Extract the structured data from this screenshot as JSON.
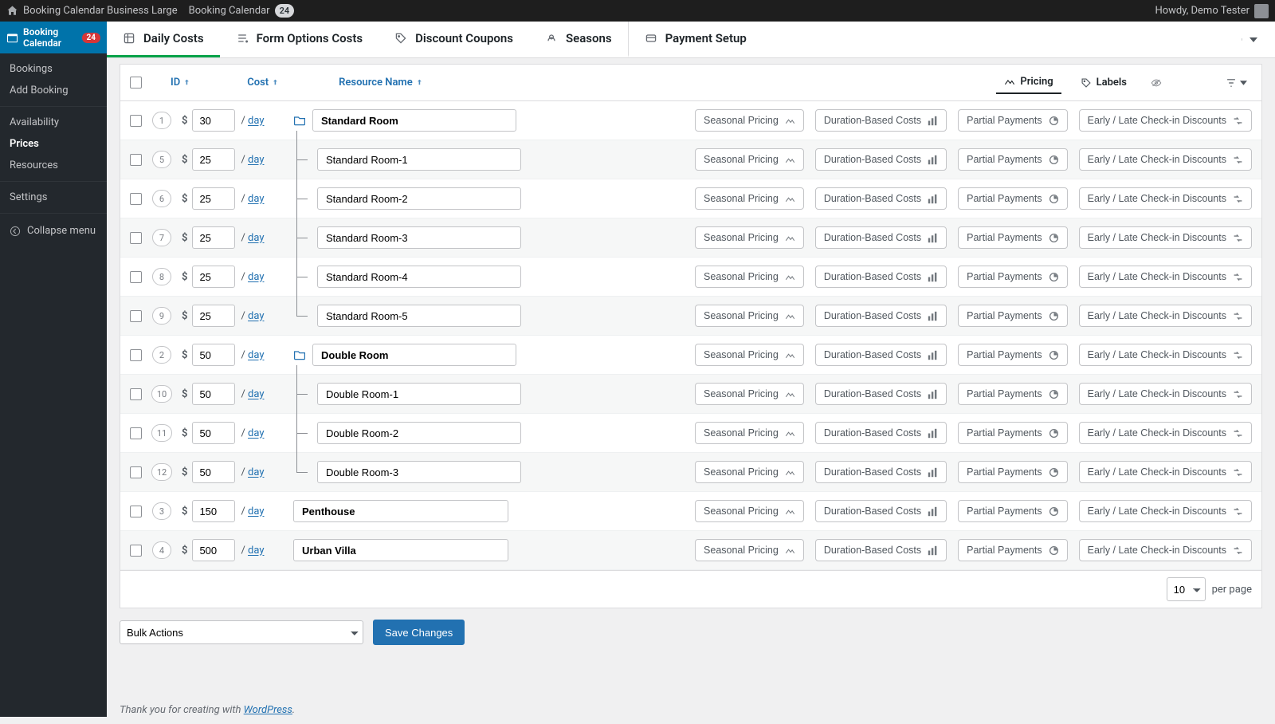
{
  "adminbar": {
    "home_label": "Booking Calendar Business Large",
    "plugin_label": "Booking Calendar",
    "plugin_badge": "24",
    "howdy": "Howdy, Demo Tester"
  },
  "sidebar": {
    "top_label": "Booking Calendar",
    "top_badge": "24",
    "group1": [
      "Bookings",
      "Add Booking"
    ],
    "group2": [
      "Availability",
      "Prices",
      "Resources"
    ],
    "group3": [
      "Settings"
    ],
    "collapse": "Collapse menu"
  },
  "tabs": [
    {
      "label": "Daily Costs",
      "active": true
    },
    {
      "label": "Form Options Costs",
      "active": false
    },
    {
      "label": "Discount Coupons",
      "active": false
    },
    {
      "label": "Seasons",
      "active": false,
      "sep": true
    },
    {
      "label": "Payment Setup",
      "active": false
    }
  ],
  "thead": {
    "id": "ID",
    "cost": "Cost",
    "resource": "Resource Name",
    "tab_pricing": "Pricing",
    "tab_labels": "Labels"
  },
  "currency": "$",
  "per_unit": "day",
  "rows": [
    {
      "id": "1",
      "cost": "30",
      "name": "Standard Room",
      "kind": "parent"
    },
    {
      "id": "5",
      "cost": "25",
      "name": "Standard Room-1",
      "kind": "child"
    },
    {
      "id": "6",
      "cost": "25",
      "name": "Standard Room-2",
      "kind": "child"
    },
    {
      "id": "7",
      "cost": "25",
      "name": "Standard Room-3",
      "kind": "child"
    },
    {
      "id": "8",
      "cost": "25",
      "name": "Standard Room-4",
      "kind": "child"
    },
    {
      "id": "9",
      "cost": "25",
      "name": "Standard Room-5",
      "kind": "child",
      "last": true
    },
    {
      "id": "2",
      "cost": "50",
      "name": "Double Room",
      "kind": "parent"
    },
    {
      "id": "10",
      "cost": "50",
      "name": "Double Room-1",
      "kind": "child"
    },
    {
      "id": "11",
      "cost": "50",
      "name": "Double Room-2",
      "kind": "child"
    },
    {
      "id": "12",
      "cost": "50",
      "name": "Double Room-3",
      "kind": "child",
      "last": true
    },
    {
      "id": "3",
      "cost": "150",
      "name": "Penthouse",
      "kind": "solo"
    },
    {
      "id": "4",
      "cost": "500",
      "name": "Urban Villa",
      "kind": "solo"
    }
  ],
  "actions": {
    "seasonal": "Seasonal Pricing",
    "duration": "Duration-Based Costs",
    "partial": "Partial Payments",
    "discounts": "Early / Late Check-in Discounts"
  },
  "footer": {
    "perpage_value": "10",
    "perpage_label": "per page"
  },
  "bulk": {
    "placeholder": "Bulk Actions",
    "save": "Save Changes"
  },
  "credit": {
    "pre": "Thank you for creating with ",
    "link": "WordPress",
    "post": "."
  }
}
